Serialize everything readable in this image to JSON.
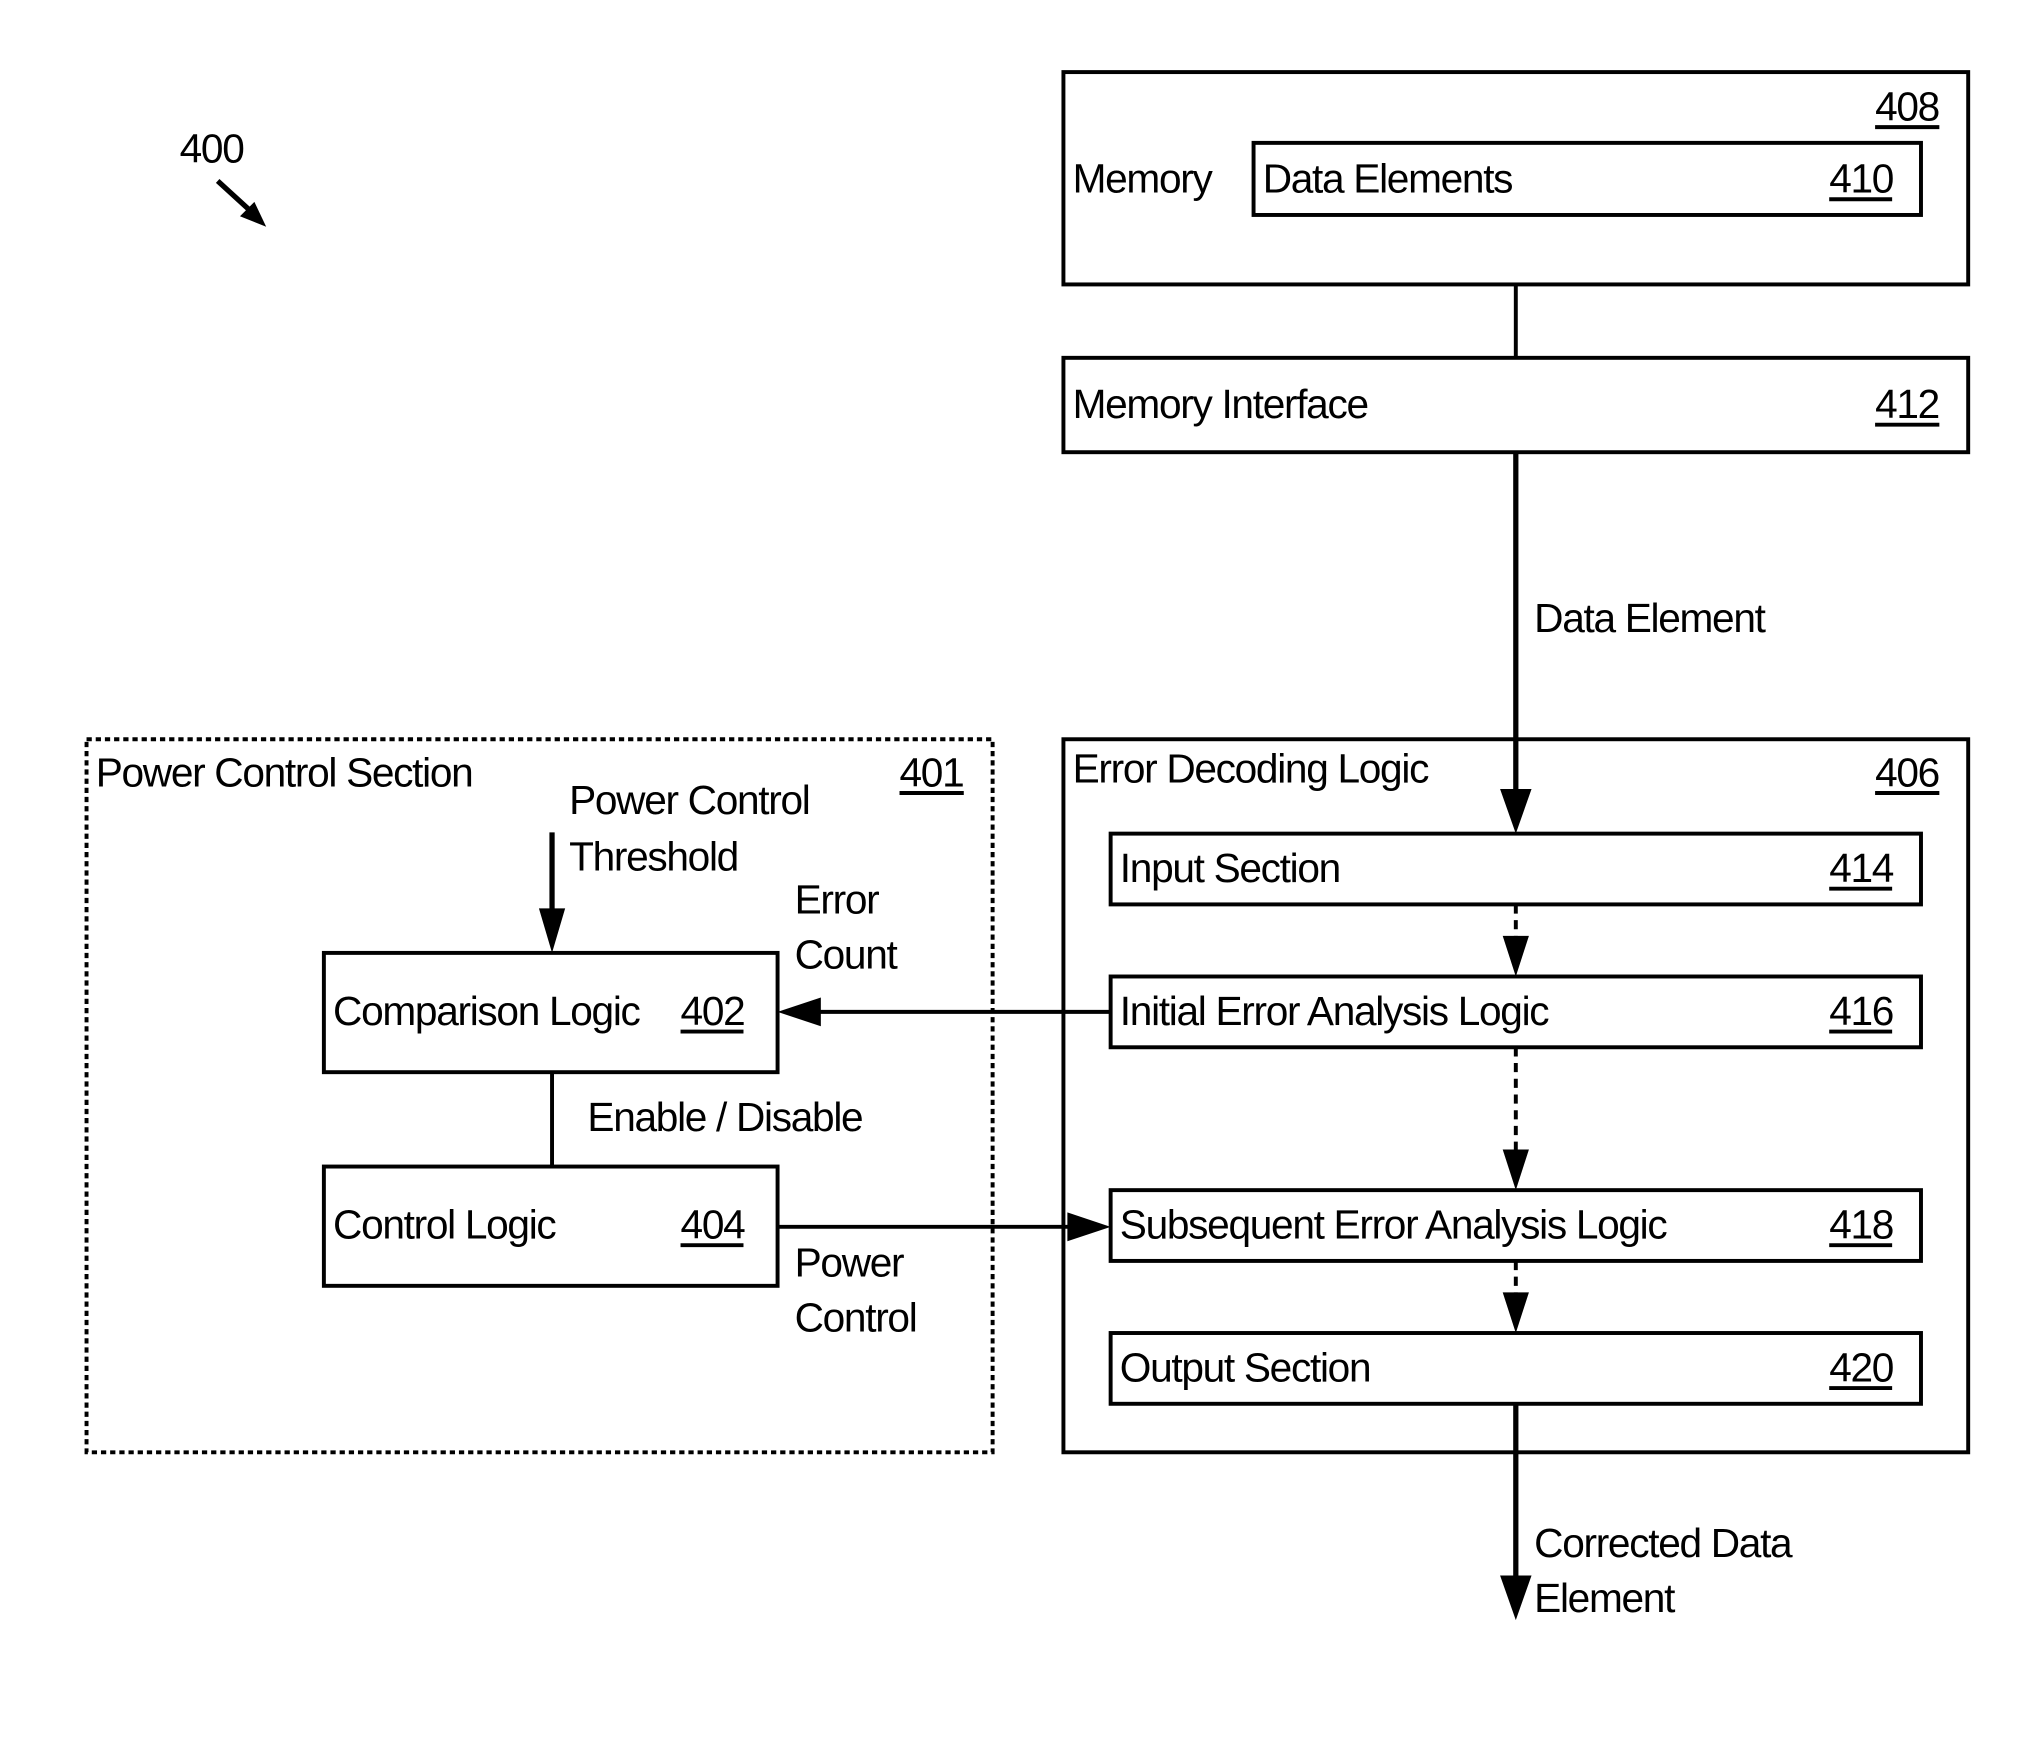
{
  "figure": {
    "ref": "400"
  },
  "power_control_section": {
    "title": "Power Control Section",
    "ref": "401",
    "threshold_label_line1": "Power Control",
    "threshold_label_line2": "Threshold",
    "comparison_logic": {
      "label": "Comparison Logic",
      "ref": "402"
    },
    "control_logic": {
      "label": "Control Logic",
      "ref": "404"
    },
    "enable_disable_label": "Enable / Disable",
    "error_count_line1": "Error",
    "error_count_line2": "Count",
    "power_control_line1": "Power",
    "power_control_line2": "Control"
  },
  "memory": {
    "label": "Memory",
    "ref": "408",
    "data_elements": {
      "label": "Data Elements",
      "ref": "410"
    }
  },
  "memory_interface": {
    "label": "Memory Interface",
    "ref": "412"
  },
  "data_element_label": "Data Element",
  "error_decoding_logic": {
    "title": "Error Decoding Logic",
    "ref": "406",
    "input_section": {
      "label": "Input Section",
      "ref": "414"
    },
    "initial_error_analysis": {
      "label": "Initial Error Analysis Logic",
      "ref": "416"
    },
    "subsequent_error_analysis": {
      "label": "Subsequent Error Analysis Logic",
      "ref": "418"
    },
    "output_section": {
      "label": "Output Section",
      "ref": "420"
    }
  },
  "corrected_label_line1": "Corrected Data",
  "corrected_label_line2": "Element"
}
